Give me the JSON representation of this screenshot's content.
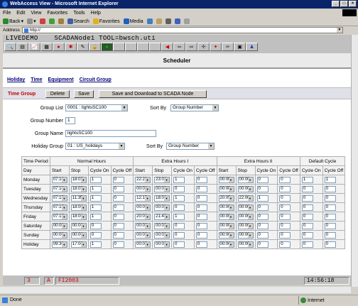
{
  "window": {
    "title": "WebAccess View - Microsoft Internet Explorer",
    "min": "_",
    "max": "□",
    "close": "×"
  },
  "menu": [
    "File",
    "Edit",
    "View",
    "Favorites",
    "Tools",
    "Help"
  ],
  "toolbar": {
    "back": "Back",
    "search": "Search",
    "favorites": "Favorites",
    "media": "Media"
  },
  "address": {
    "label": "Address",
    "value": "http://"
  },
  "scada": {
    "header": "LIVEDEMO    SCADANode1 TOOL=bwsch.uti"
  },
  "scheduler": {
    "title": "Scheduler",
    "nav": [
      "Holiday",
      "Time",
      "Equipment",
      "Circuit Group"
    ],
    "section": "Time Group",
    "buttons": {
      "delete": "Delete",
      "save": "Save",
      "save_download": "Save and Download to SCADA Node"
    },
    "group_list_label": "Group List",
    "group_list_value": "0001 : lightsSC100",
    "sort_by_label": "Sort By",
    "sort_by_value": "Group Number",
    "group_number_label": "Group Number",
    "group_number_value": "1",
    "group_name_label": "Group Name",
    "group_name_value": "lightsSC100",
    "holiday_group_label": "Holiday Group",
    "holiday_group_value": "01 : US_holidays",
    "sort_by2_label": "Sort By",
    "sort_by2_value": "Group Number"
  },
  "grid": {
    "time_period": "Time Period",
    "day": "Day",
    "groups": [
      "Normal Hours",
      "Extra Hours I",
      "Extra Hours II",
      "Default Cycle"
    ],
    "sub": {
      "start": "Start",
      "stop": "Stop",
      "cycle_on": "Cycle On",
      "cycle_off": "Cycle Off"
    },
    "rows": [
      {
        "day": "Monday",
        "n": [
          "07:10",
          "18:05",
          "1",
          "0"
        ],
        "e1": [
          "22:20",
          "23:00",
          "1",
          "0"
        ],
        "e2": [
          "00:00",
          "00:00",
          "0",
          "0"
        ],
        "d": [
          "1",
          "1"
        ]
      },
      {
        "day": "Tuesday",
        "n": [
          "07:10",
          "18:05",
          "1",
          "0"
        ],
        "e1": [
          "00:00",
          "00:00",
          "0",
          "0"
        ],
        "e2": [
          "00:00",
          "00:00",
          "0",
          "0"
        ],
        "d": [
          "0",
          "0"
        ]
      },
      {
        "day": "Wednesday",
        "n": [
          "07:15",
          "11:35",
          "1",
          "0"
        ],
        "e1": [
          "12:15",
          "18:00",
          "1",
          "0"
        ],
        "e2": [
          "20:05",
          "22:00",
          "1",
          "0"
        ],
        "d": [
          "0",
          "0"
        ]
      },
      {
        "day": "Thursday",
        "n": [
          "07:15",
          "18:00",
          "1",
          "0"
        ],
        "e1": [
          "00:00",
          "00:00",
          "0",
          "0"
        ],
        "e2": [
          "00:00",
          "00:00",
          "0",
          "0"
        ],
        "d": [
          "0",
          "0"
        ]
      },
      {
        "day": "Friday",
        "n": [
          "07:15",
          "18:00",
          "1",
          "0"
        ],
        "e1": [
          "20:00",
          "21:45",
          "1",
          "0"
        ],
        "e2": [
          "00:00",
          "00:00",
          "0",
          "0"
        ],
        "d": [
          "0",
          "0"
        ]
      },
      {
        "day": "Saturday",
        "n": [
          "00:00",
          "00:00",
          "0",
          "0"
        ],
        "e1": [
          "00:00",
          "00:00",
          "0",
          "0"
        ],
        "e2": [
          "00:00",
          "00:00",
          "0",
          "0"
        ],
        "d": [
          "0",
          "0"
        ]
      },
      {
        "day": "Sunday",
        "n": [
          "00:00",
          "00:00",
          "0",
          "0"
        ],
        "e1": [
          "00:00",
          "00:00",
          "0",
          "0"
        ],
        "e2": [
          "00:00",
          "00:00",
          "0",
          "0"
        ],
        "d": [
          "0",
          "0"
        ]
      },
      {
        "day": "Holiday",
        "n": [
          "09:30",
          "17:00",
          "1",
          "0"
        ],
        "e1": [
          "00:00",
          "00:00",
          "0",
          "0"
        ],
        "e2": [
          "00:00",
          "00:00",
          "0",
          "0"
        ],
        "d": [
          "0",
          "0"
        ]
      }
    ]
  },
  "footer": {
    "alarm_count": "3",
    "alarm_flag": "A",
    "tag": "FI2003",
    "clock": "14:56:18"
  },
  "status": {
    "left": "Done",
    "zone": "Internet"
  }
}
